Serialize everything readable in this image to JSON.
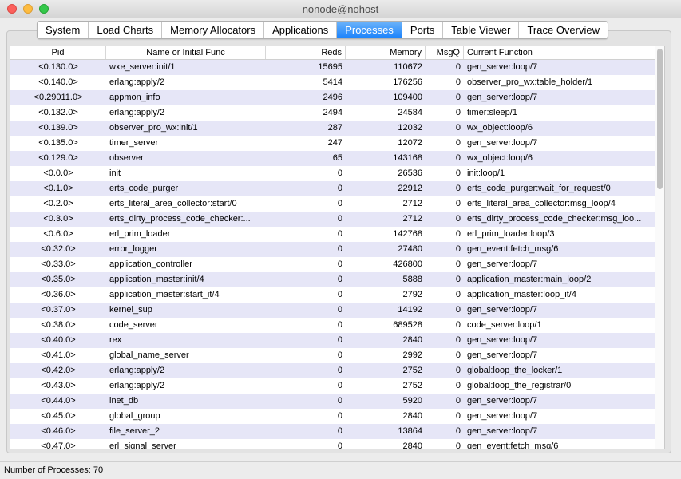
{
  "window": {
    "title": "nonode@nohost"
  },
  "tabs": [
    {
      "label": "System",
      "active": false
    },
    {
      "label": "Load Charts",
      "active": false
    },
    {
      "label": "Memory Allocators",
      "active": false
    },
    {
      "label": "Applications",
      "active": false
    },
    {
      "label": "Processes",
      "active": true
    },
    {
      "label": "Ports",
      "active": false
    },
    {
      "label": "Table Viewer",
      "active": false
    },
    {
      "label": "Trace Overview",
      "active": false
    }
  ],
  "table": {
    "columns": [
      "Pid",
      "Name or Initial Func",
      "Reds",
      "Memory",
      "MsgQ",
      "Current Function"
    ],
    "rows": [
      [
        "<0.130.0>",
        "wxe_server:init/1",
        "15695",
        "110672",
        "0",
        "gen_server:loop/7"
      ],
      [
        "<0.140.0>",
        "erlang:apply/2",
        "5414",
        "176256",
        "0",
        "observer_pro_wx:table_holder/1"
      ],
      [
        "<0.29011.0>",
        "appmon_info",
        "2496",
        "109400",
        "0",
        "gen_server:loop/7"
      ],
      [
        "<0.132.0>",
        "erlang:apply/2",
        "2494",
        "24584",
        "0",
        "timer:sleep/1"
      ],
      [
        "<0.139.0>",
        "observer_pro_wx:init/1",
        "287",
        "12032",
        "0",
        "wx_object:loop/6"
      ],
      [
        "<0.135.0>",
        "timer_server",
        "247",
        "12072",
        "0",
        "gen_server:loop/7"
      ],
      [
        "<0.129.0>",
        "observer",
        "65",
        "143168",
        "0",
        "wx_object:loop/6"
      ],
      [
        "<0.0.0>",
        "init",
        "0",
        "26536",
        "0",
        "init:loop/1"
      ],
      [
        "<0.1.0>",
        "erts_code_purger",
        "0",
        "22912",
        "0",
        "erts_code_purger:wait_for_request/0"
      ],
      [
        "<0.2.0>",
        "erts_literal_area_collector:start/0",
        "0",
        "2712",
        "0",
        "erts_literal_area_collector:msg_loop/4"
      ],
      [
        "<0.3.0>",
        "erts_dirty_process_code_checker:...",
        "0",
        "2712",
        "0",
        "erts_dirty_process_code_checker:msg_loo..."
      ],
      [
        "<0.6.0>",
        "erl_prim_loader",
        "0",
        "142768",
        "0",
        "erl_prim_loader:loop/3"
      ],
      [
        "<0.32.0>",
        "error_logger",
        "0",
        "27480",
        "0",
        "gen_event:fetch_msg/6"
      ],
      [
        "<0.33.0>",
        "application_controller",
        "0",
        "426800",
        "0",
        "gen_server:loop/7"
      ],
      [
        "<0.35.0>",
        "application_master:init/4",
        "0",
        "5888",
        "0",
        "application_master:main_loop/2"
      ],
      [
        "<0.36.0>",
        "application_master:start_it/4",
        "0",
        "2792",
        "0",
        "application_master:loop_it/4"
      ],
      [
        "<0.37.0>",
        "kernel_sup",
        "0",
        "14192",
        "0",
        "gen_server:loop/7"
      ],
      [
        "<0.38.0>",
        "code_server",
        "0",
        "689528",
        "0",
        "code_server:loop/1"
      ],
      [
        "<0.40.0>",
        "rex",
        "0",
        "2840",
        "0",
        "gen_server:loop/7"
      ],
      [
        "<0.41.0>",
        "global_name_server",
        "0",
        "2992",
        "0",
        "gen_server:loop/7"
      ],
      [
        "<0.42.0>",
        "erlang:apply/2",
        "0",
        "2752",
        "0",
        "global:loop_the_locker/1"
      ],
      [
        "<0.43.0>",
        "erlang:apply/2",
        "0",
        "2752",
        "0",
        "global:loop_the_registrar/0"
      ],
      [
        "<0.44.0>",
        "inet_db",
        "0",
        "5920",
        "0",
        "gen_server:loop/7"
      ],
      [
        "<0.45.0>",
        "global_group",
        "0",
        "2840",
        "0",
        "gen_server:loop/7"
      ],
      [
        "<0.46.0>",
        "file_server_2",
        "0",
        "13864",
        "0",
        "gen_server:loop/7"
      ],
      [
        "<0.47.0>",
        "erl_signal_server",
        "0",
        "2840",
        "0",
        "gen_event:fetch_msg/6"
      ]
    ]
  },
  "status": {
    "text": "Number of Processes: 70"
  }
}
